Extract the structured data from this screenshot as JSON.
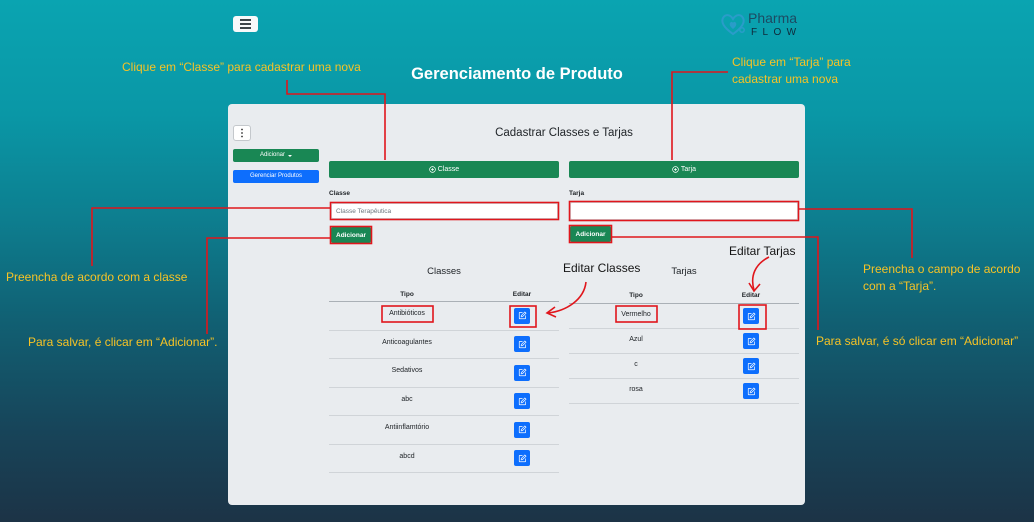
{
  "header": {
    "menu_icon": "hamburger-icon",
    "logo": {
      "icon": "stethoscope-heart-icon",
      "word1": "Pharma",
      "word2": "FLOW"
    },
    "page_title": "Gerenciamento de Produto"
  },
  "sidebar": {
    "more_icon": "vertical-dots-icon",
    "add_dropdown": "Adicionar",
    "add_dropdown_icon": "caret-down-icon",
    "manage_products": "Gerenciar Produtos"
  },
  "main": {
    "heading": "Cadastrar Classes e Tarjas",
    "classe_toggle": "Classe",
    "tarja_toggle": "Tarja",
    "toggle_icon": "plus-circle-icon",
    "classe_form": {
      "label": "Classe",
      "placeholder": "Classe Terapêutica",
      "value": "",
      "submit": "Adicionar"
    },
    "tarja_form": {
      "label": "Tarja",
      "placeholder": "",
      "value": "",
      "submit": "Adicionar"
    },
    "classes_table": {
      "title": "Classes",
      "columns": [
        "Tipo",
        "Editar"
      ],
      "edit_icon": "edit-icon",
      "rows": [
        "Antibióticos",
        "Anticoagulantes",
        "Sedativos",
        "abc",
        "Antiinflamtório",
        "abcd"
      ]
    },
    "tarjas_table": {
      "title": "Tarjas",
      "columns": [
        "Tipo",
        "Editar"
      ],
      "edit_icon": "edit-icon",
      "rows": [
        "Vermelho",
        "Azul",
        "c",
        "rosa"
      ]
    }
  },
  "annotations": {
    "classe_toggle_hint": "Clique em “Classe” para cadastrar uma nova",
    "tarja_toggle_hint": [
      "Clique em “Tarja” para",
      "cadastrar uma nova"
    ],
    "classe_input_hint": "Preencha de acordo com a classe",
    "classe_save_hint": "Para salvar, é clicar em “Adicionar”.",
    "edit_classes_hint": "Editar Classes",
    "edit_tarjas_hint": "Editar Tarjas",
    "tarja_input_hint": [
      "Preencha o campo de acordo",
      "com a “Tarja”."
    ],
    "tarja_save_hint": "Para salvar, é só clicar em “Adicionar”"
  },
  "colors": {
    "annotation_text": "#f7c325",
    "annotation_line": "#e0161c",
    "success": "#198754",
    "primary": "#0d6efd",
    "panel": "#e9ecef",
    "title": "#ffffff"
  }
}
